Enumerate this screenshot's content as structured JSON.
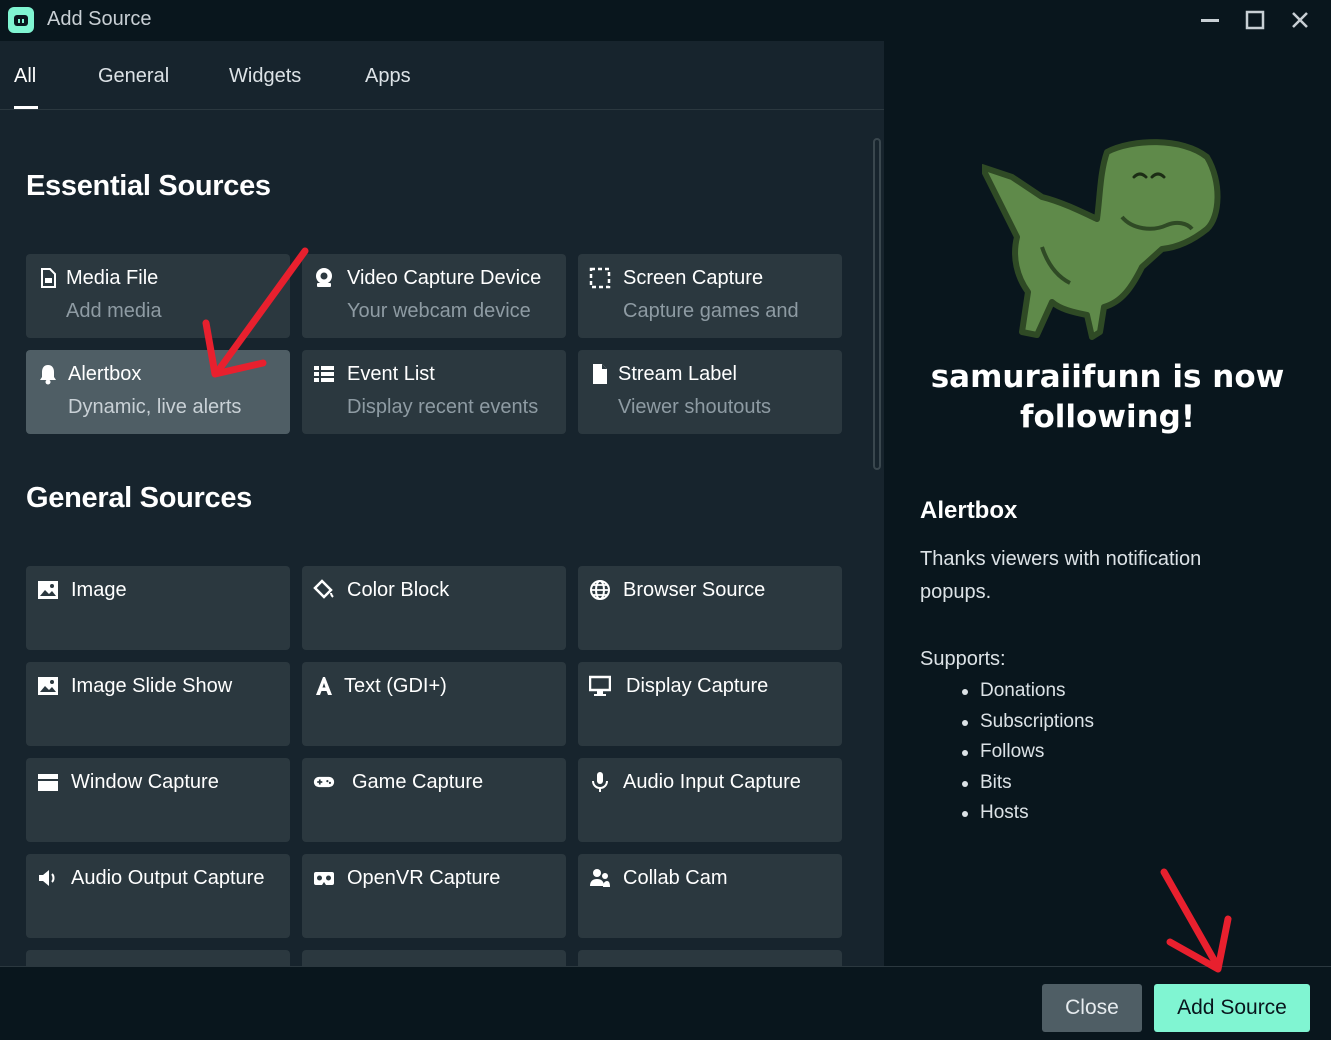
{
  "window": {
    "title": "Add Source"
  },
  "tabs": [
    {
      "label": "All"
    },
    {
      "label": "General"
    },
    {
      "label": "Widgets"
    },
    {
      "label": "Apps"
    }
  ],
  "essential": {
    "title": "Essential Sources",
    "items": [
      {
        "name": "Media File",
        "desc": "Add media",
        "icon": "file-video-icon"
      },
      {
        "name": "Video Capture Device",
        "desc": "Your webcam device",
        "icon": "webcam-icon"
      },
      {
        "name": "Screen Capture",
        "desc": "Capture games and",
        "icon": "screen-select-icon"
      },
      {
        "name": "Alertbox",
        "desc": "Dynamic, live alerts",
        "icon": "bell-icon"
      },
      {
        "name": "Event List",
        "desc": "Display recent events",
        "icon": "list-icon"
      },
      {
        "name": "Stream Label",
        "desc": "Viewer shoutouts",
        "icon": "document-icon"
      }
    ]
  },
  "general": {
    "title": "General Sources",
    "items": [
      {
        "name": "Image",
        "icon": "image-icon"
      },
      {
        "name": "Color Block",
        "icon": "paint-bucket-icon"
      },
      {
        "name": "Browser Source",
        "icon": "globe-icon"
      },
      {
        "name": "Image Slide Show",
        "icon": "image-icon"
      },
      {
        "name": "Text (GDI+)",
        "icon": "text-icon"
      },
      {
        "name": "Display Capture",
        "icon": "monitor-icon"
      },
      {
        "name": "Window Capture",
        "icon": "window-icon"
      },
      {
        "name": "Game Capture",
        "icon": "gamepad-icon"
      },
      {
        "name": "Audio Input Capture",
        "icon": "microphone-icon"
      },
      {
        "name": "Audio Output Capture",
        "icon": "speaker-icon"
      },
      {
        "name": "OpenVR Capture",
        "icon": "vr-headset-icon"
      },
      {
        "name": "Collab Cam",
        "icon": "users-icon"
      }
    ]
  },
  "preview": {
    "text": "samuraiifunn is now following!"
  },
  "detail": {
    "title": "Alertbox",
    "description": "Thanks viewers with notification popups.",
    "supports_label": "Supports:",
    "supports": [
      "Donations",
      "Subscriptions",
      "Follows",
      "Bits",
      "Hosts"
    ]
  },
  "footer": {
    "close_label": "Close",
    "add_label": "Add Source"
  },
  "colors": {
    "accent": "#80f5d2",
    "selected_card": "#4f5e65",
    "card": "#2b383f",
    "annotation": "#e8202e"
  }
}
